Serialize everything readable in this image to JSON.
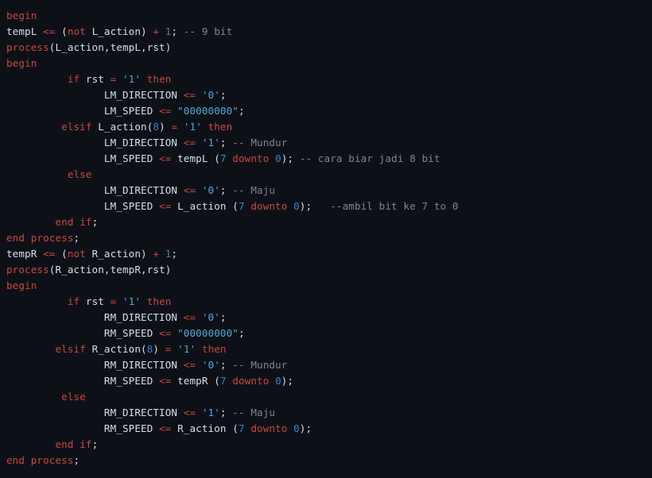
{
  "editor": {
    "language": "VHDL",
    "background_color": "#0d1117",
    "colors": {
      "keyword": "#c9463f",
      "operator": "#c9463f",
      "identifier": "#d8dee9",
      "string": "#58a6d8",
      "number": "#3b82c4",
      "comment": "#7d8590"
    },
    "lines": [
      {
        "n": 1,
        "tokens": [
          {
            "t": "begin",
            "c": "kw"
          }
        ]
      },
      {
        "n": 2,
        "tokens": [
          {
            "t": "tempL ",
            "c": "id"
          },
          {
            "t": "<=",
            "c": "op"
          },
          {
            "t": " ",
            "c": "plain"
          },
          {
            "t": "(",
            "c": "punct"
          },
          {
            "t": "not",
            "c": "kw"
          },
          {
            "t": " L_action",
            "c": "id"
          },
          {
            "t": ")",
            "c": "punct"
          },
          {
            "t": " ",
            "c": "plain"
          },
          {
            "t": "+",
            "c": "op"
          },
          {
            "t": " ",
            "c": "plain"
          },
          {
            "t": "1",
            "c": "num"
          },
          {
            "t": ";",
            "c": "punct"
          },
          {
            "t": " ",
            "c": "plain"
          },
          {
            "t": "-- 9 bit",
            "c": "comment"
          }
        ]
      },
      {
        "n": 3,
        "tokens": [
          {
            "t": "process",
            "c": "fn"
          },
          {
            "t": "(L_action,tempL,rst)",
            "c": "id"
          }
        ]
      },
      {
        "n": 4,
        "tokens": [
          {
            "t": "begin",
            "c": "kw"
          }
        ]
      },
      {
        "n": 5,
        "tokens": [
          {
            "t": "          ",
            "c": "plain"
          },
          {
            "t": "if",
            "c": "kw"
          },
          {
            "t": " rst ",
            "c": "id"
          },
          {
            "t": "=",
            "c": "op"
          },
          {
            "t": " ",
            "c": "plain"
          },
          {
            "t": "'1'",
            "c": "str"
          },
          {
            "t": " ",
            "c": "plain"
          },
          {
            "t": "then",
            "c": "kw"
          }
        ]
      },
      {
        "n": 6,
        "tokens": [
          {
            "t": "                ",
            "c": "plain"
          },
          {
            "t": "LM_DIRECTION ",
            "c": "id"
          },
          {
            "t": "<=",
            "c": "op"
          },
          {
            "t": " ",
            "c": "plain"
          },
          {
            "t": "'0'",
            "c": "str"
          },
          {
            "t": ";",
            "c": "punct"
          }
        ]
      },
      {
        "n": 7,
        "tokens": [
          {
            "t": "                ",
            "c": "plain"
          },
          {
            "t": "LM_SPEED ",
            "c": "id"
          },
          {
            "t": "<=",
            "c": "op"
          },
          {
            "t": " ",
            "c": "plain"
          },
          {
            "t": "\"00000000\"",
            "c": "str"
          },
          {
            "t": ";",
            "c": "punct"
          }
        ]
      },
      {
        "n": 8,
        "tokens": [
          {
            "t": "         ",
            "c": "plain"
          },
          {
            "t": "elsif",
            "c": "kw"
          },
          {
            "t": " L_action",
            "c": "id"
          },
          {
            "t": "(",
            "c": "punct"
          },
          {
            "t": "8",
            "c": "num"
          },
          {
            "t": ")",
            "c": "punct"
          },
          {
            "t": " ",
            "c": "plain"
          },
          {
            "t": "=",
            "c": "op"
          },
          {
            "t": " ",
            "c": "plain"
          },
          {
            "t": "'1'",
            "c": "str"
          },
          {
            "t": " ",
            "c": "plain"
          },
          {
            "t": "then",
            "c": "kw"
          }
        ]
      },
      {
        "n": 9,
        "tokens": [
          {
            "t": "                ",
            "c": "plain"
          },
          {
            "t": "LM_DIRECTION ",
            "c": "id"
          },
          {
            "t": "<=",
            "c": "op"
          },
          {
            "t": " ",
            "c": "plain"
          },
          {
            "t": "'1'",
            "c": "str"
          },
          {
            "t": ";",
            "c": "punct"
          },
          {
            "t": " ",
            "c": "plain"
          },
          {
            "t": "-- Mundur",
            "c": "comment"
          }
        ]
      },
      {
        "n": 10,
        "tokens": [
          {
            "t": "                ",
            "c": "plain"
          },
          {
            "t": "LM_SPEED ",
            "c": "id"
          },
          {
            "t": "<=",
            "c": "op"
          },
          {
            "t": " tempL ",
            "c": "id"
          },
          {
            "t": "(",
            "c": "punct"
          },
          {
            "t": "7",
            "c": "num"
          },
          {
            "t": " ",
            "c": "plain"
          },
          {
            "t": "downto",
            "c": "kw"
          },
          {
            "t": " ",
            "c": "plain"
          },
          {
            "t": "0",
            "c": "num"
          },
          {
            "t": ");",
            "c": "punct"
          },
          {
            "t": " ",
            "c": "plain"
          },
          {
            "t": "-- cara biar jadi 8 bit",
            "c": "comment"
          }
        ]
      },
      {
        "n": 11,
        "tokens": [
          {
            "t": "          ",
            "c": "plain"
          },
          {
            "t": "else",
            "c": "kw"
          }
        ]
      },
      {
        "n": 12,
        "tokens": [
          {
            "t": "                ",
            "c": "plain"
          },
          {
            "t": "LM_DIRECTION ",
            "c": "id"
          },
          {
            "t": "<=",
            "c": "op"
          },
          {
            "t": " ",
            "c": "plain"
          },
          {
            "t": "'0'",
            "c": "str"
          },
          {
            "t": ";",
            "c": "punct"
          },
          {
            "t": " ",
            "c": "plain"
          },
          {
            "t": "-- Maju",
            "c": "comment"
          }
        ]
      },
      {
        "n": 13,
        "tokens": [
          {
            "t": "                ",
            "c": "plain"
          },
          {
            "t": "LM_SPEED ",
            "c": "id"
          },
          {
            "t": "<=",
            "c": "op"
          },
          {
            "t": " L_action ",
            "c": "id"
          },
          {
            "t": "(",
            "c": "punct"
          },
          {
            "t": "7",
            "c": "num"
          },
          {
            "t": " ",
            "c": "plain"
          },
          {
            "t": "downto",
            "c": "kw"
          },
          {
            "t": " ",
            "c": "plain"
          },
          {
            "t": "0",
            "c": "num"
          },
          {
            "t": ");",
            "c": "punct"
          },
          {
            "t": "   ",
            "c": "plain"
          },
          {
            "t": "--ambil bit ke 7 to 0",
            "c": "comment"
          }
        ]
      },
      {
        "n": 14,
        "tokens": [
          {
            "t": "        ",
            "c": "plain"
          },
          {
            "t": "end",
            "c": "kw"
          },
          {
            "t": " ",
            "c": "plain"
          },
          {
            "t": "if",
            "c": "kw"
          },
          {
            "t": ";",
            "c": "punct"
          }
        ]
      },
      {
        "n": 15,
        "tokens": [
          {
            "t": "end",
            "c": "kw"
          },
          {
            "t": " ",
            "c": "plain"
          },
          {
            "t": "process",
            "c": "fn"
          },
          {
            "t": ";",
            "c": "punct"
          }
        ]
      },
      {
        "n": 16,
        "tokens": [
          {
            "t": "tempR ",
            "c": "id"
          },
          {
            "t": "<=",
            "c": "op"
          },
          {
            "t": " ",
            "c": "plain"
          },
          {
            "t": "(",
            "c": "punct"
          },
          {
            "t": "not",
            "c": "kw"
          },
          {
            "t": " R_action",
            "c": "id"
          },
          {
            "t": ")",
            "c": "punct"
          },
          {
            "t": " ",
            "c": "plain"
          },
          {
            "t": "+",
            "c": "op"
          },
          {
            "t": " ",
            "c": "plain"
          },
          {
            "t": "1",
            "c": "num"
          },
          {
            "t": ";",
            "c": "punct"
          }
        ]
      },
      {
        "n": 17,
        "tokens": [
          {
            "t": "process",
            "c": "fn"
          },
          {
            "t": "(R_action,tempR,rst)",
            "c": "id"
          }
        ]
      },
      {
        "n": 18,
        "tokens": [
          {
            "t": "begin",
            "c": "kw"
          }
        ]
      },
      {
        "n": 19,
        "tokens": [
          {
            "t": "          ",
            "c": "plain"
          },
          {
            "t": "if",
            "c": "kw"
          },
          {
            "t": " rst ",
            "c": "id"
          },
          {
            "t": "=",
            "c": "op"
          },
          {
            "t": " ",
            "c": "plain"
          },
          {
            "t": "'1'",
            "c": "str"
          },
          {
            "t": " ",
            "c": "plain"
          },
          {
            "t": "then",
            "c": "kw"
          }
        ]
      },
      {
        "n": 20,
        "tokens": [
          {
            "t": "                ",
            "c": "plain"
          },
          {
            "t": "RM_DIRECTION ",
            "c": "id"
          },
          {
            "t": "<=",
            "c": "op"
          },
          {
            "t": " ",
            "c": "plain"
          },
          {
            "t": "'0'",
            "c": "str"
          },
          {
            "t": ";",
            "c": "punct"
          }
        ]
      },
      {
        "n": 21,
        "tokens": [
          {
            "t": "                ",
            "c": "plain"
          },
          {
            "t": "RM_SPEED ",
            "c": "id"
          },
          {
            "t": "<=",
            "c": "op"
          },
          {
            "t": " ",
            "c": "plain"
          },
          {
            "t": "\"00000000\"",
            "c": "str"
          },
          {
            "t": ";",
            "c": "punct"
          }
        ]
      },
      {
        "n": 22,
        "tokens": [
          {
            "t": "        ",
            "c": "plain"
          },
          {
            "t": "elsif",
            "c": "kw"
          },
          {
            "t": " R_action",
            "c": "id"
          },
          {
            "t": "(",
            "c": "punct"
          },
          {
            "t": "8",
            "c": "num"
          },
          {
            "t": ")",
            "c": "punct"
          },
          {
            "t": " ",
            "c": "plain"
          },
          {
            "t": "=",
            "c": "op"
          },
          {
            "t": " ",
            "c": "plain"
          },
          {
            "t": "'1'",
            "c": "str"
          },
          {
            "t": " ",
            "c": "plain"
          },
          {
            "t": "then",
            "c": "kw"
          }
        ]
      },
      {
        "n": 23,
        "tokens": [
          {
            "t": "                ",
            "c": "plain"
          },
          {
            "t": "RM_DIRECTION ",
            "c": "id"
          },
          {
            "t": "<=",
            "c": "op"
          },
          {
            "t": " ",
            "c": "plain"
          },
          {
            "t": "'0'",
            "c": "str"
          },
          {
            "t": ";",
            "c": "punct"
          },
          {
            "t": " ",
            "c": "plain"
          },
          {
            "t": "-- Mundur",
            "c": "comment"
          }
        ]
      },
      {
        "n": 24,
        "tokens": [
          {
            "t": "                ",
            "c": "plain"
          },
          {
            "t": "RM_SPEED ",
            "c": "id"
          },
          {
            "t": "<=",
            "c": "op"
          },
          {
            "t": " tempR ",
            "c": "id"
          },
          {
            "t": "(",
            "c": "punct"
          },
          {
            "t": "7",
            "c": "num"
          },
          {
            "t": " ",
            "c": "plain"
          },
          {
            "t": "downto",
            "c": "kw"
          },
          {
            "t": " ",
            "c": "plain"
          },
          {
            "t": "0",
            "c": "num"
          },
          {
            "t": ");",
            "c": "punct"
          }
        ]
      },
      {
        "n": 25,
        "tokens": [
          {
            "t": "         ",
            "c": "plain"
          },
          {
            "t": "else",
            "c": "kw"
          }
        ]
      },
      {
        "n": 26,
        "tokens": [
          {
            "t": "                ",
            "c": "plain"
          },
          {
            "t": "RM_DIRECTION ",
            "c": "id"
          },
          {
            "t": "<=",
            "c": "op"
          },
          {
            "t": " ",
            "c": "plain"
          },
          {
            "t": "'1'",
            "c": "str"
          },
          {
            "t": ";",
            "c": "punct"
          },
          {
            "t": " ",
            "c": "plain"
          },
          {
            "t": "-- Maju",
            "c": "comment"
          }
        ]
      },
      {
        "n": 27,
        "tokens": [
          {
            "t": "                ",
            "c": "plain"
          },
          {
            "t": "RM_SPEED ",
            "c": "id"
          },
          {
            "t": "<=",
            "c": "op"
          },
          {
            "t": " R_action ",
            "c": "id"
          },
          {
            "t": "(",
            "c": "punct"
          },
          {
            "t": "7",
            "c": "num"
          },
          {
            "t": " ",
            "c": "plain"
          },
          {
            "t": "downto",
            "c": "kw"
          },
          {
            "t": " ",
            "c": "plain"
          },
          {
            "t": "0",
            "c": "num"
          },
          {
            "t": ");",
            "c": "punct"
          }
        ]
      },
      {
        "n": 28,
        "tokens": [
          {
            "t": "        ",
            "c": "plain"
          },
          {
            "t": "end",
            "c": "kw"
          },
          {
            "t": " ",
            "c": "plain"
          },
          {
            "t": "if",
            "c": "kw"
          },
          {
            "t": ";",
            "c": "punct"
          }
        ]
      },
      {
        "n": 29,
        "tokens": [
          {
            "t": "end",
            "c": "kw"
          },
          {
            "t": " ",
            "c": "plain"
          },
          {
            "t": "process",
            "c": "fn"
          },
          {
            "t": ";",
            "c": "punct"
          }
        ]
      }
    ]
  }
}
